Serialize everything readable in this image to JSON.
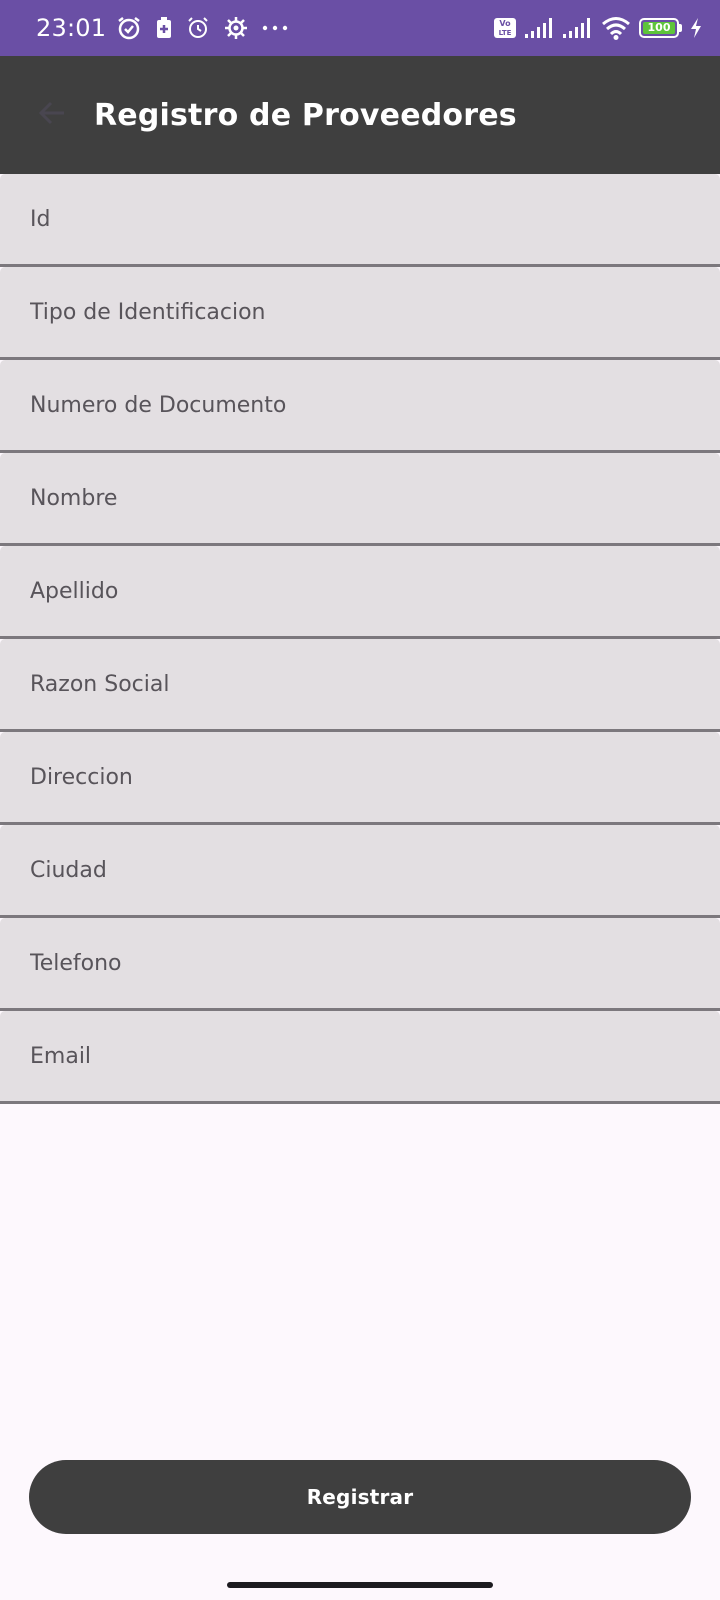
{
  "status_bar": {
    "time": "23:01",
    "background_color": "#6a4fa5",
    "left_icons": [
      "alarm-icon",
      "battery-saver-icon",
      "alarm-outline-icon",
      "settings-icon",
      "more-dots-icon"
    ],
    "volte_label": "Vo\nLTE",
    "battery_level": "100",
    "right_icons": [
      "volte-icon",
      "signal-icon",
      "signal-icon",
      "wifi-icon",
      "battery-icon",
      "charging-icon"
    ]
  },
  "app_bar": {
    "title": "Registro de Proveedores",
    "background_color": "#3f3f3f",
    "back_icon": "arrow-back-icon"
  },
  "form": {
    "fields": [
      {
        "placeholder": "Id",
        "value": ""
      },
      {
        "placeholder": "Tipo de Identificacion",
        "value": ""
      },
      {
        "placeholder": "Numero de Documento",
        "value": ""
      },
      {
        "placeholder": "Nombre",
        "value": ""
      },
      {
        "placeholder": "Apellido",
        "value": ""
      },
      {
        "placeholder": "Razon Social",
        "value": ""
      },
      {
        "placeholder": "Direccion",
        "value": ""
      },
      {
        "placeholder": "Ciudad",
        "value": ""
      },
      {
        "placeholder": "Telefono",
        "value": ""
      },
      {
        "placeholder": "Email",
        "value": ""
      }
    ],
    "field_background": "#e3dfe2",
    "field_underline": "#7c787d"
  },
  "register_button": {
    "label": "Registrar",
    "background_color": "#3f3f3f"
  }
}
